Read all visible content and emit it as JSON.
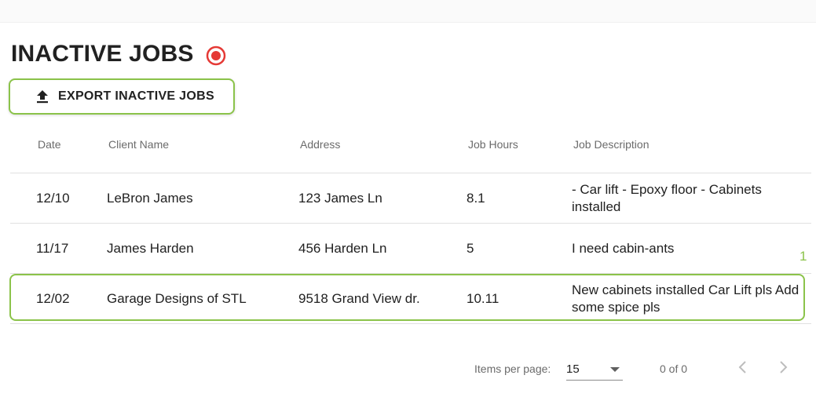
{
  "page": {
    "title": "INACTIVE JOBS",
    "record_icon": "record-icon",
    "accent_color": "#8bc34a",
    "record_color": "#e53935"
  },
  "toolbar": {
    "export_label": "EXPORT INACTIVE JOBS",
    "export_icon": "upload-icon"
  },
  "table": {
    "columns": {
      "date": "Date",
      "client": "Client Name",
      "address": "Address",
      "hours": "Job Hours",
      "description": "Job Description"
    },
    "rows": [
      {
        "date": "12/10",
        "client": "LeBron James",
        "address": "123 James Ln",
        "hours": "8.1",
        "description": "- Car lift - Epoxy floor - Cabinets installed"
      },
      {
        "date": "11/17",
        "client": "James Harden",
        "address": "456 Harden Ln",
        "hours": "5",
        "description": "I need cabin-ants"
      },
      {
        "date": "12/02",
        "client": "Garage Designs of STL",
        "address": "9518 Grand View dr.",
        "hours": "10.11",
        "description": "New cabinets installed Car Lift pls Add some spice pls"
      }
    ],
    "selected_row_badge": "1"
  },
  "paginator": {
    "items_per_page_label": "Items per page:",
    "items_per_page_value": "15",
    "range_label": "0 of 0",
    "prev_icon": "chevron-left-icon",
    "next_icon": "chevron-right-icon"
  }
}
